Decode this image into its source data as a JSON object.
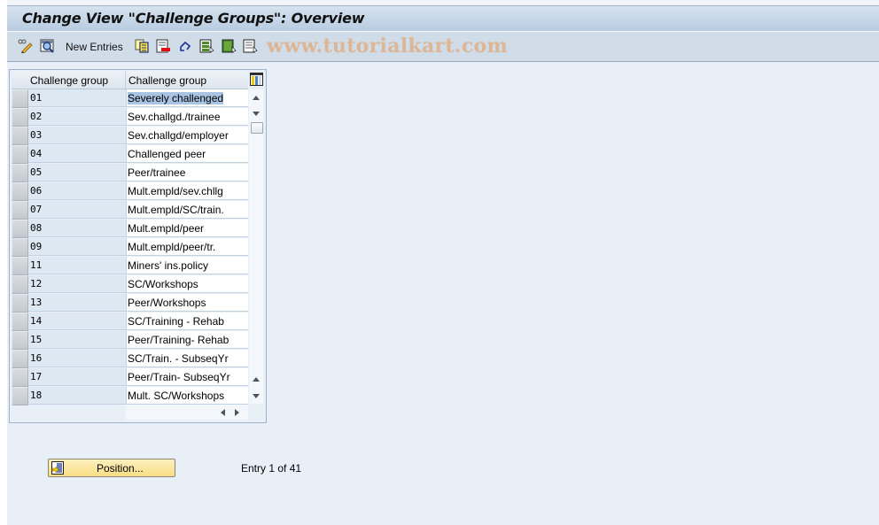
{
  "window": {
    "title": "Change View \"Challenge Groups\": Overview"
  },
  "toolbar": {
    "items": [
      {
        "name": "display-change-toggle",
        "icon": "pencil-glasses-icon"
      },
      {
        "name": "get-variant",
        "icon": "magnifier-table-icon"
      },
      {
        "name": "new-entries",
        "label": "New Entries"
      },
      {
        "name": "copy-as",
        "icon": "copy-icon"
      },
      {
        "name": "delete",
        "icon": "delete-row-icon"
      },
      {
        "name": "undo-change",
        "icon": "undo-icon"
      },
      {
        "name": "select-all",
        "icon": "select-all-icon"
      },
      {
        "name": "select-block",
        "icon": "select-block-icon"
      },
      {
        "name": "deselect-all",
        "icon": "deselect-all-icon"
      }
    ],
    "watermark": "www.tutorialkart.com"
  },
  "table": {
    "columns": [
      "Challenge group",
      "Challenge group"
    ],
    "rows": [
      {
        "code": "01",
        "text": "Severely challenged",
        "highlighted": true
      },
      {
        "code": "02",
        "text": "Sev.challgd./trainee"
      },
      {
        "code": "03",
        "text": "Sev.challgd/employer"
      },
      {
        "code": "04",
        "text": "Challenged peer"
      },
      {
        "code": "05",
        "text": "Peer/trainee"
      },
      {
        "code": "06",
        "text": "Mult.empld/sev.chllg"
      },
      {
        "code": "07",
        "text": "Mult.empld/SC/train."
      },
      {
        "code": "08",
        "text": "Mult.empld/peer"
      },
      {
        "code": "09",
        "text": "Mult.empld/peer/tr."
      },
      {
        "code": "11",
        "text": "Miners' ins.policy"
      },
      {
        "code": "12",
        "text": "SC/Workshops"
      },
      {
        "code": "13",
        "text": "Peer/Workshops"
      },
      {
        "code": "14",
        "text": "SC/Training - Rehab"
      },
      {
        "code": "15",
        "text": "Peer/Training- Rehab"
      },
      {
        "code": "16",
        "text": "SC/Train. - SubseqYr"
      },
      {
        "code": "17",
        "text": "Peer/Train- SubseqYr"
      },
      {
        "code": "18",
        "text": "Mult. SC/Workshops"
      }
    ]
  },
  "footer": {
    "position_button": "Position...",
    "entry_status": "Entry 1 of 41"
  },
  "colors": {
    "title_bar": "#c6d6e8",
    "toolbar": "#d0dde8",
    "background": "#e9eff7",
    "key_column": "#dde8f3",
    "selection": "#a9c3e3",
    "position_button": "#f8de85",
    "watermark": "#e6a060"
  }
}
